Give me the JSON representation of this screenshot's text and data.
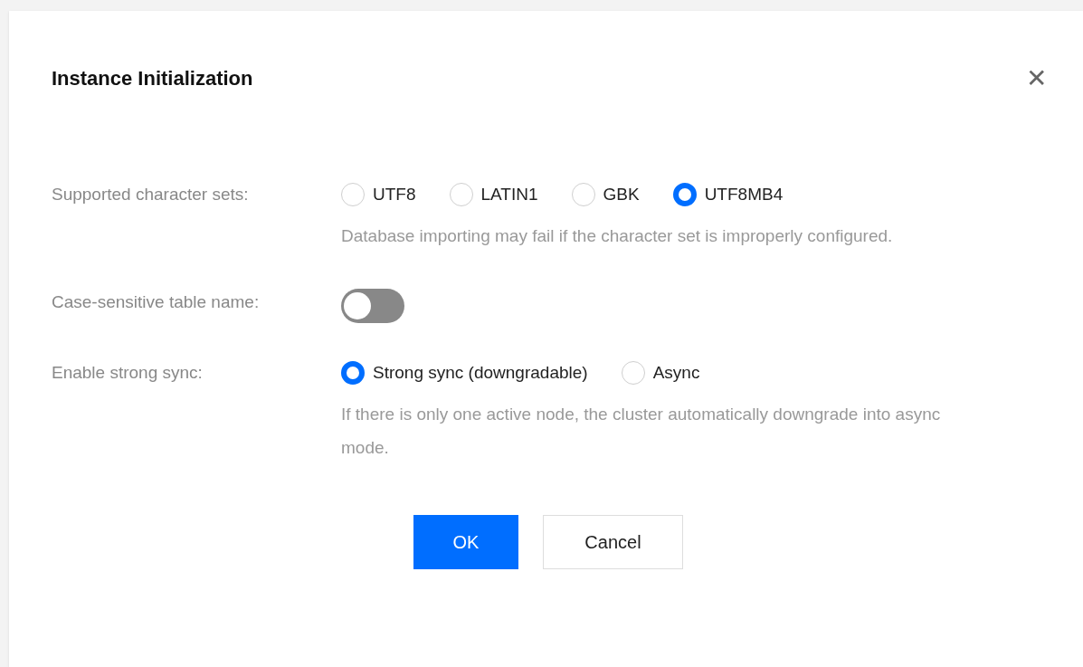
{
  "dialog": {
    "title": "Instance Initialization",
    "close": "✕"
  },
  "fields": [
    {
      "kind": "radio",
      "label": "Supported character sets:",
      "options": [
        {
          "label": "UTF8",
          "selected": false
        },
        {
          "label": "LATIN1",
          "selected": false
        },
        {
          "label": "GBK",
          "selected": false
        },
        {
          "label": "UTF8MB4",
          "selected": true
        }
      ],
      "hint": "Database importing may fail if the character set is improperly configured."
    },
    {
      "kind": "switch",
      "label": "Case-sensitive table name:",
      "on": false
    },
    {
      "kind": "radio",
      "label": "Enable strong sync:",
      "options": [
        {
          "label": "Strong sync (downgradable)",
          "selected": true
        },
        {
          "label": "Async",
          "selected": false
        }
      ],
      "hint": "If there is only one active node, the cluster automatically downgrade into async mode."
    }
  ],
  "buttons": [
    {
      "label": "OK",
      "kind": "primary"
    },
    {
      "label": "Cancel",
      "kind": "secondary"
    }
  ]
}
